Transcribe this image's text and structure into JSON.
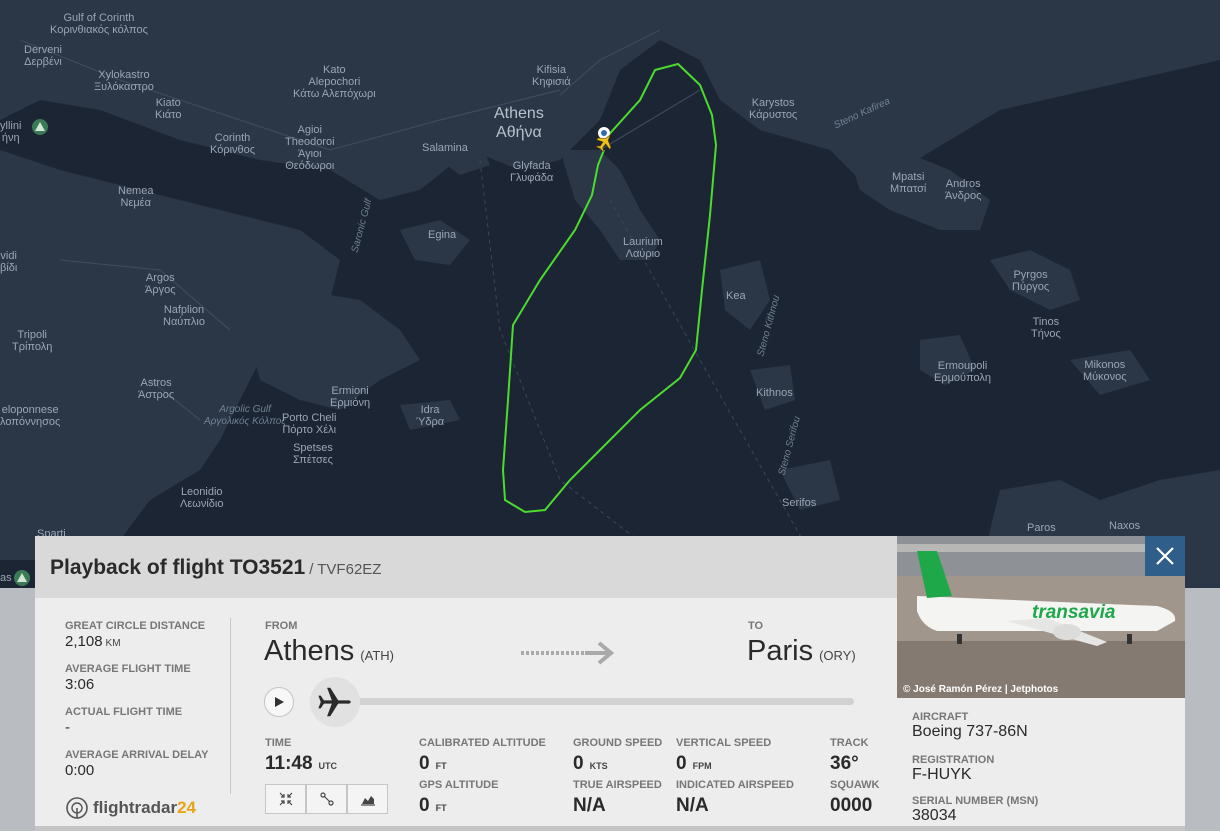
{
  "map": {
    "labels": {
      "gulf_of_corinth": "Gulf of Corinth",
      "gulf_of_corinth_gr": "Κορινθιακός κόλπος",
      "derveni": "Derveni",
      "derveni_gr": "Δερβένι",
      "xylokastro": "Xylokastro",
      "xylokastro_gr": "Ξυλόκαστρο",
      "kato_alepochori": "Kato\nAlepochori",
      "kato_alepochori_gr": "Κάτω Αλεπόχωρι",
      "kiato": "Kiato",
      "kiato_gr": "Κιάτο",
      "kyllini": "yllini",
      "kyllini_gr": "ήνη",
      "corinth": "Corinth",
      "corinth_gr": "Κόρινθος",
      "agioi_theodoroi": "Agioi\nTheodoroi",
      "agioi_theodoroi_gr": "Άγιοι\nΘεόδωροι",
      "nemea": "Nemea",
      "nemea_gr": "Νεμέα",
      "vidi": "vidi",
      "vidi_gr": "βίδι",
      "kifisia": "Kifisia",
      "kifisia_gr": "Κηφισιά",
      "athens": "Athens",
      "athens_gr": "Αθήνα",
      "salamina": "Salamina",
      "glyfada": "Glyfada",
      "glyfada_gr": "Γλυφάδα",
      "saronic_gulf": "Saronic Gulf",
      "egina": "Egina",
      "lavrio": "Laurium",
      "lavrio_gr": "Λαύριο",
      "karystos": "Karystos",
      "karystos_gr": "Κάρυστος",
      "steno_kafirea": "Steno Kafirea",
      "mpatsi": "Mpatsi",
      "mpatsi_gr": "Μπατσί",
      "andros": "Andros",
      "andros_gr": "Άνδρος",
      "argos": "Argos",
      "argos_gr": "Άργος",
      "nafplion": "Nafplion",
      "nafplion_gr": "Ναύπλιο",
      "kea": "Kea",
      "steno_kithnou": "Steno Kithnou",
      "pyrgos": "Pyrgos",
      "pyrgos_gr": "Πύργος",
      "tinos": "Tinos",
      "tinos_gr": "Τήνος",
      "tripoli": "Tripoli",
      "tripoli_gr": "Τρίπολη",
      "astros": "Astros",
      "astros_gr": "Άστρος",
      "ermioni": "Ermioni",
      "ermioni_gr": "Ερμιόνη",
      "argolic_gulf": "Argolic Gulf",
      "argolic_gulf_gr": "Αργολικός Κόλπος",
      "porto_cheli": "Porto Cheli",
      "porto_cheli_gr": "Πόρτο Χέλι",
      "idra": "Idra",
      "idra_gr": "Ύδρα",
      "kithnos": "Kithnos",
      "ermoupoli": "Ermoupoli",
      "ermoupoli_gr": "Ερμούπολη",
      "mikonos": "Mikonos",
      "mikonos_gr": "Μύκονος",
      "peloponnese": "eloponnese",
      "peloponnese_gr": "λοπόννησος",
      "spetses": "Spetses",
      "spetses_gr": "Σπέτσες",
      "leonidio": "Leonidio",
      "leonidio_gr": "Λεωνίδιο",
      "steno_serifou": "Steno Serifou",
      "serifos": "Serifos",
      "paros": "Paros",
      "naxos": "Naxos",
      "sparti": "Sparti",
      "as": "as"
    }
  },
  "panel": {
    "title": "Playback of flight TO3521",
    "subtitle": "/ TVF62EZ",
    "great_circle_distance": {
      "label": "GREAT CIRCLE DISTANCE",
      "value": "2,108",
      "unit": "KM"
    },
    "average_flight_time": {
      "label": "AVERAGE FLIGHT TIME",
      "value": "3:06"
    },
    "actual_flight_time": {
      "label": "ACTUAL FLIGHT TIME",
      "value": "-"
    },
    "average_arrival_delay": {
      "label": "AVERAGE ARRIVAL DELAY",
      "value": "0:00"
    },
    "brand": "flightradar24",
    "from": {
      "label": "FROM",
      "city": "Athens",
      "code": "(ATH)"
    },
    "to": {
      "label": "TO",
      "city": "Paris",
      "code": "(ORY)"
    },
    "playback_progress": 0.0,
    "time": {
      "label": "TIME",
      "value": "11:48",
      "unit": "UTC"
    },
    "calibrated_altitude": {
      "label": "CALIBRATED ALTITUDE",
      "value": "0",
      "unit": "FT"
    },
    "gps_altitude": {
      "label": "GPS ALTITUDE",
      "value": "0",
      "unit": "FT"
    },
    "ground_speed": {
      "label": "GROUND SPEED",
      "value": "0",
      "unit": "KTS"
    },
    "true_airspeed": {
      "label": "TRUE AIRSPEED",
      "value": "N/A"
    },
    "vertical_speed": {
      "label": "VERTICAL SPEED",
      "value": "0",
      "unit": "FPM"
    },
    "indicated_airspeed": {
      "label": "INDICATED AIRSPEED",
      "value": "N/A"
    },
    "track": {
      "label": "TRACK",
      "value": "36°"
    },
    "squawk": {
      "label": "SQUAWK",
      "value": "0000"
    },
    "photo_credit": "© José Ramón Pérez | Jetphotos",
    "photo_livery": "transavia",
    "aircraft": {
      "label": "AIRCRAFT",
      "value": "Boeing 737-86N"
    },
    "registration": {
      "label": "REGISTRATION",
      "value": "F-HUYK"
    },
    "serial_number": {
      "label": "SERIAL NUMBER (MSN)",
      "value": "38034"
    }
  },
  "colors": {
    "map_sea": "#1c2533",
    "map_land": "#2b3747",
    "track": "#4cdb2e",
    "accent": "#2f5e8a",
    "plane_marker": "#f0c419"
  },
  "icons": [
    "play-icon",
    "plane-icon",
    "collapse-icon",
    "route-icon",
    "chart-icon",
    "close-icon",
    "flightradar24-logo-icon",
    "airport-pin-icon",
    "arrow-dashed-icon"
  ]
}
